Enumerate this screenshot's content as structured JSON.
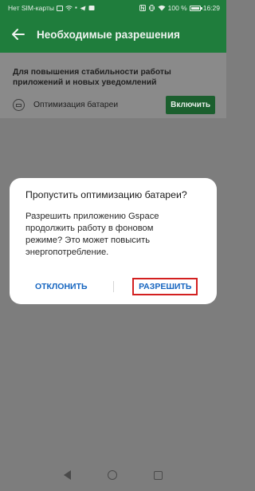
{
  "status_bar": {
    "carrier": "Нет SIM-карты",
    "battery_text": "100 %",
    "battery_level": 1.0,
    "time": "16:29"
  },
  "app_bar": {
    "title": "Необходимые разрешения",
    "back_icon": "arrow-left-icon"
  },
  "content": {
    "description": "Для повышения стабильности работы приложений и новых уведомлений",
    "permission": {
      "icon": "battery-icon",
      "label": "Оптимизация батареи",
      "button": "Включить"
    }
  },
  "dialog": {
    "title": "Пропустить оптимизацию батареи?",
    "body": "Разрешить приложению Gspace продолжить работу в фоновом режиме? Это может повысить энергопотребление.",
    "deny": "ОТКЛОНИТЬ",
    "allow": "РАЗРЕШИТЬ",
    "highlight_color": "#d32020"
  },
  "colors": {
    "app_bar": "#1f7d3c",
    "accent_text": "#1565c0"
  }
}
